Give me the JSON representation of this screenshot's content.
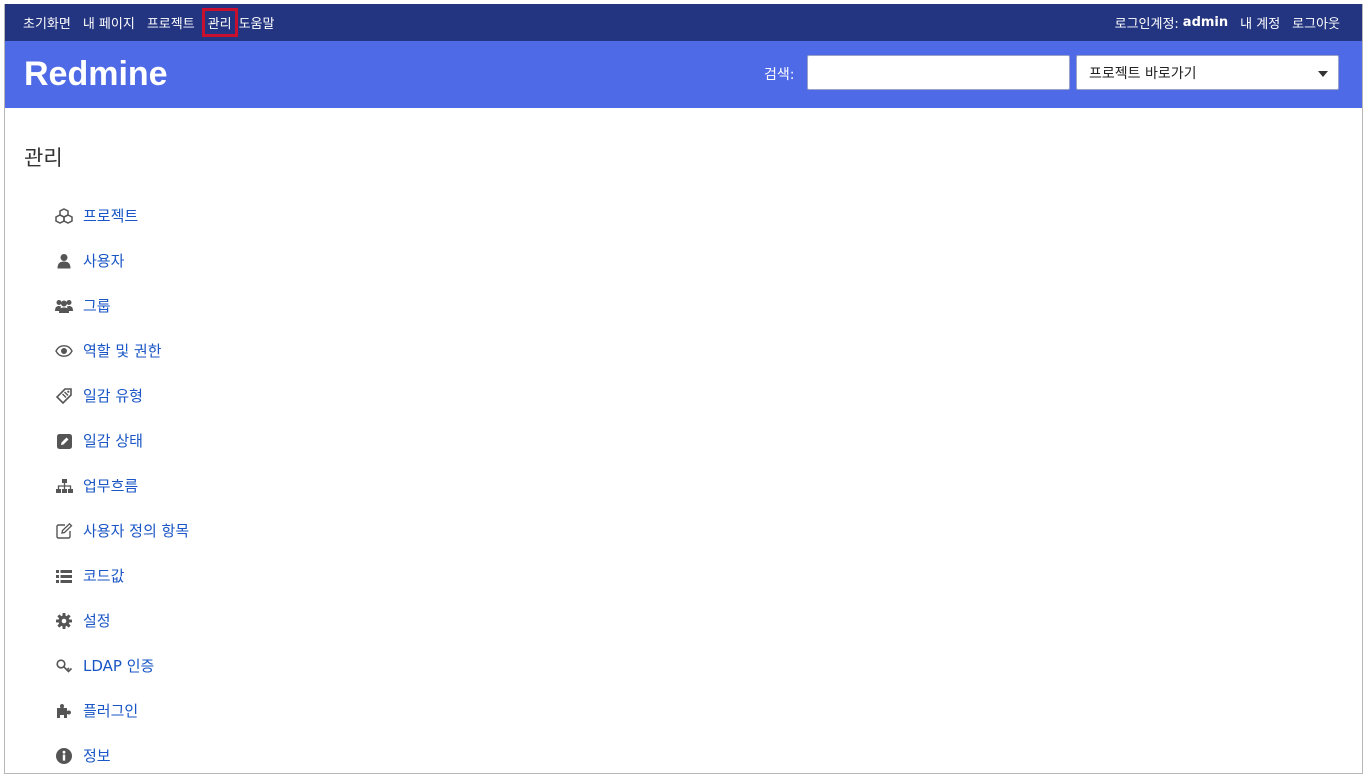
{
  "top_menu": {
    "items": [
      {
        "label": "초기화면"
      },
      {
        "label": "내 페이지"
      },
      {
        "label": "프로젝트"
      },
      {
        "label": "관리"
      },
      {
        "label": "도움말"
      }
    ],
    "logged_as_label": "로그인계정:",
    "username": "admin",
    "my_account": "내 계정",
    "logout": "로그아웃"
  },
  "header": {
    "logo": "Redmine",
    "search_label": "검색:",
    "search_value": "",
    "project_jump": "프로젝트 바로가기"
  },
  "content": {
    "title": "관리",
    "menu": [
      {
        "label": "프로젝트",
        "icon": "projects-icon"
      },
      {
        "label": "사용자",
        "icon": "user-icon"
      },
      {
        "label": "그룹",
        "icon": "group-icon"
      },
      {
        "label": "역할 및 권한",
        "icon": "eye-icon"
      },
      {
        "label": "일감 유형",
        "icon": "tag-icon"
      },
      {
        "label": "일감 상태",
        "icon": "edit-square-icon"
      },
      {
        "label": "업무흐름",
        "icon": "sitemap-icon"
      },
      {
        "label": "사용자 정의 항목",
        "icon": "edit-outline-icon"
      },
      {
        "label": "코드값",
        "icon": "list-icon"
      },
      {
        "label": "설정",
        "icon": "gear-icon"
      },
      {
        "label": "LDAP 인증",
        "icon": "key-icon"
      },
      {
        "label": "플러그인",
        "icon": "puzzle-icon"
      },
      {
        "label": "정보",
        "icon": "info-icon"
      }
    ]
  },
  "colors": {
    "top_menu_bg": "#233480",
    "header_bg": "#4f6ae6",
    "link": "#1a56c5",
    "selected_outline": "#c8102e"
  }
}
